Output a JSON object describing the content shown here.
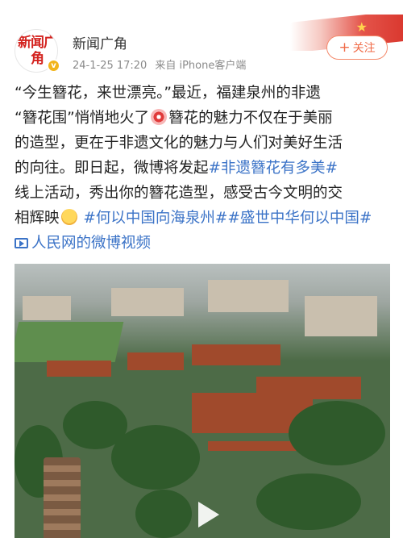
{
  "author": {
    "avatar_text": "新闻广角",
    "name": "新闻广角",
    "date": "24-1-25 17:20",
    "source": "来自 iPhone客户端"
  },
  "follow_button": {
    "label": "关注",
    "icon": "plus-icon"
  },
  "post": {
    "line1": "“今生簪花，来世漂亮。”最近，福建泉州的非遗",
    "line2a": "“簪花围”悄悄地火了",
    "emoji1": "flower-emoji",
    "line2b": "簪花的魅力不仅在于美丽",
    "line3": "的造型，更在于非遗文化的魅力与人们对美好生活",
    "line4a": "的向往。即日起，微博将发起",
    "tag1": "#非遗簪花有多美#",
    "line5": "线上活动，秀出你的簪花造型，感受古今文明的交",
    "line6a": "相辉映",
    "emoji2": "face-emoji",
    "tag2": "#何以中国向海泉州#",
    "tag3": "#盛世中华何以中国#",
    "video_link": "人民网的微博视频"
  },
  "video": {
    "play_icon": "play-icon",
    "overlay_icon": "video-icon"
  },
  "colors": {
    "link": "#3b73c7",
    "follow": "#f06b48"
  }
}
